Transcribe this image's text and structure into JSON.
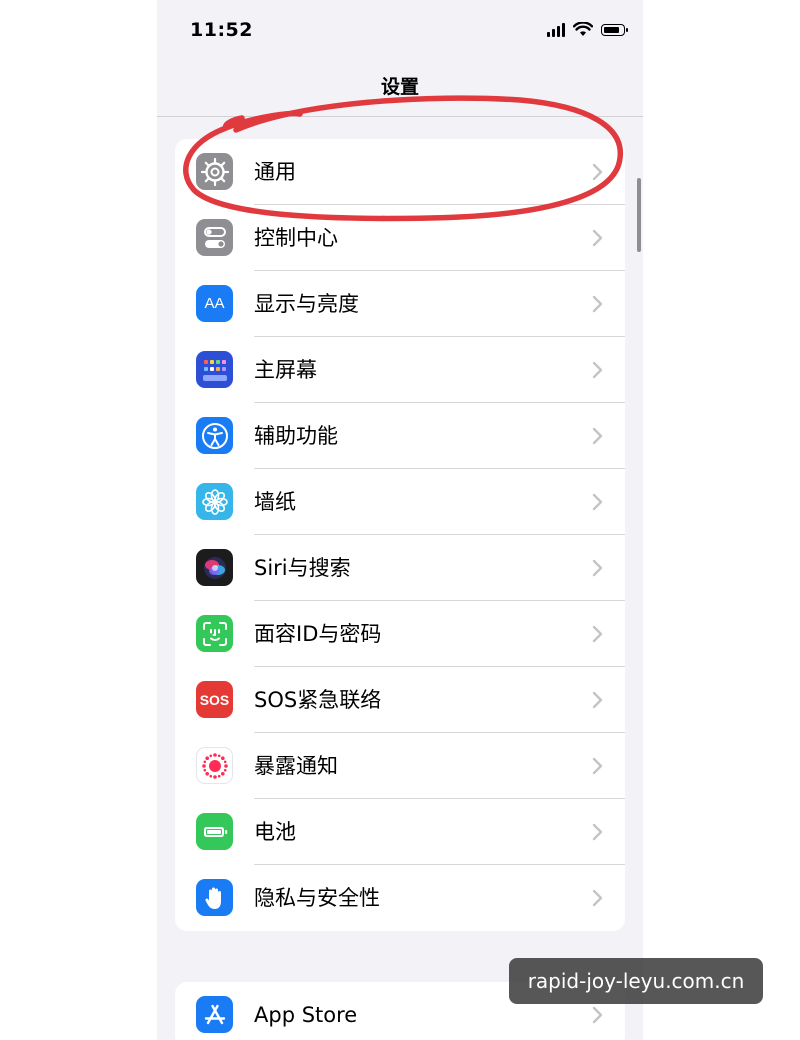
{
  "status_bar": {
    "time": "11:52"
  },
  "nav": {
    "title": "设置"
  },
  "settings_group_1": {
    "items": [
      {
        "label": "通用",
        "icon": "gear-icon",
        "color": "#8e8e93"
      },
      {
        "label": "控制中心",
        "icon": "toggles-icon",
        "color": "#8e8e93"
      },
      {
        "label": "显示与亮度",
        "icon": "text-size-icon",
        "color": "#1a7cf5",
        "icon_text": "AA"
      },
      {
        "label": "主屏幕",
        "icon": "home-grid-icon",
        "color": "#2c4fd6"
      },
      {
        "label": "辅助功能",
        "icon": "accessibility-icon",
        "color": "#1a7cf5"
      },
      {
        "label": "墙纸",
        "icon": "flower-icon",
        "color": "#35b5e8"
      },
      {
        "label": "Siri与搜索",
        "icon": "siri-icon",
        "color": "#1c1c1e"
      },
      {
        "label": "面容ID与密码",
        "icon": "face-id-icon",
        "color": "#34c759"
      },
      {
        "label": "SOS紧急联络",
        "icon": "sos-icon",
        "color": "#e53935",
        "icon_text": "SOS"
      },
      {
        "label": "暴露通知",
        "icon": "exposure-icon",
        "color": "#ffffff"
      },
      {
        "label": "电池",
        "icon": "battery-icon",
        "color": "#34c759"
      },
      {
        "label": "隐私与安全性",
        "icon": "hand-icon",
        "color": "#1a7cf5"
      }
    ]
  },
  "settings_group_2": {
    "items": [
      {
        "label": "App Store",
        "icon": "app-store-icon",
        "color": "#1a7cf5"
      }
    ]
  },
  "annotation": {
    "color": "#e0393e"
  },
  "watermark": {
    "text": "rapid-joy-leyu.com.cn"
  }
}
